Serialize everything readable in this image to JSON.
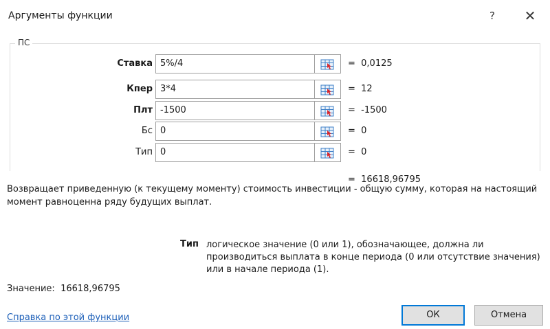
{
  "window": {
    "title": "Аргументы функции",
    "help_glyph": "?",
    "close_glyph": "✕"
  },
  "function": {
    "name": "ПС",
    "arguments": [
      {
        "label": "Ставка",
        "bold": true,
        "value": "5%/4",
        "result": "=  0,0125"
      },
      {
        "label": "Кпер",
        "bold": true,
        "value": "3*4",
        "result": "=  12"
      },
      {
        "label": "Плт",
        "bold": true,
        "value": "-1500",
        "result": "=  -1500"
      },
      {
        "label": "Бс",
        "bold": false,
        "value": "0",
        "result": "=  0"
      },
      {
        "label": "Тип",
        "bold": false,
        "value": "0",
        "result": "=  0"
      }
    ],
    "formula_result": "=  16618,96795",
    "description": "Возвращает приведенную (к текущему моменту) стоимость инвестиции - общую сумму, которая на настоящий момент равноценна ряду будущих выплат.",
    "arg_help": {
      "name": "Тип",
      "text": "логическое значение (0 или 1), обозначающее, должна ли производиться выплата в конце периода (0 или отсутствие значения) или в начале периода (1)."
    },
    "value_line": "Значение:  16618,96795",
    "help_link": "Справка по этой функции"
  },
  "buttons": {
    "ok": "ОК",
    "cancel": "Отмена"
  },
  "icons": {
    "ref_button_icon": "range-select-icon",
    "ref_icon_colors": {
      "grid": "#3b7ec7",
      "fill": "#e8f1fb",
      "arrow": "#d9262c"
    }
  }
}
